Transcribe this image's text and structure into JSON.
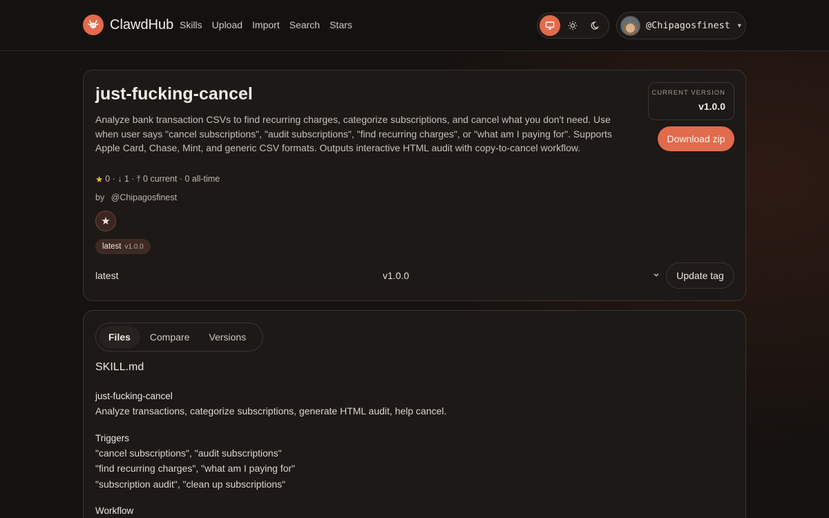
{
  "app": {
    "name": "ClawdHub",
    "nav": [
      "Skills",
      "Upload",
      "Import",
      "Search",
      "Stars"
    ],
    "user": "@Chipagosfinest"
  },
  "skill": {
    "title": "just-fucking-cancel",
    "description": "Analyze bank transaction CSVs to find recurring charges, categorize subscriptions, and cancel what you don't need. Use when user says \"cancel subscriptions\", \"audit subscriptions\", \"find recurring charges\", or \"what am I paying for\". Supports Apple Card, Chase, Mint, and generic CSV formats. Outputs interactive HTML audit with copy-to-cancel workflow.",
    "version_label": "CURRENT VERSION",
    "version": "v1.0.0",
    "download_label": "Download zip",
    "stats": "0 · ↓ 1 · ⤒ 0 current · 0 all-time",
    "by_label": "by",
    "author": "@Chipagosfinest",
    "tag": {
      "name": "latest",
      "version": "v1.0.0"
    },
    "tag_row": {
      "label": "latest",
      "version": "v1.0.0",
      "button": "Update tag"
    }
  },
  "files_panel": {
    "tabs": [
      "Files",
      "Compare",
      "Versions"
    ],
    "active_tab": "Files",
    "file_name": "SKILL.md",
    "content": {
      "heading": "just-fucking-cancel",
      "summary": "Analyze transactions, categorize subscriptions, generate HTML audit, help cancel.",
      "triggers_heading": "Triggers",
      "triggers": [
        "\"cancel subscriptions\", \"audit subscriptions\"",
        "\"find recurring charges\", \"what am I paying for\"",
        "\"subscription audit\", \"clean up subscriptions\""
      ],
      "workflow_heading": "Workflow"
    }
  },
  "colors": {
    "accent": "#e46a4c",
    "background": "#16120f",
    "card": "#1c1917"
  },
  "icons": {
    "logo": "lobster-icon",
    "theme": [
      "monitor-icon",
      "sun-icon",
      "moon-icon"
    ],
    "star": "star-icon",
    "chevron": "chevron-down-icon"
  }
}
